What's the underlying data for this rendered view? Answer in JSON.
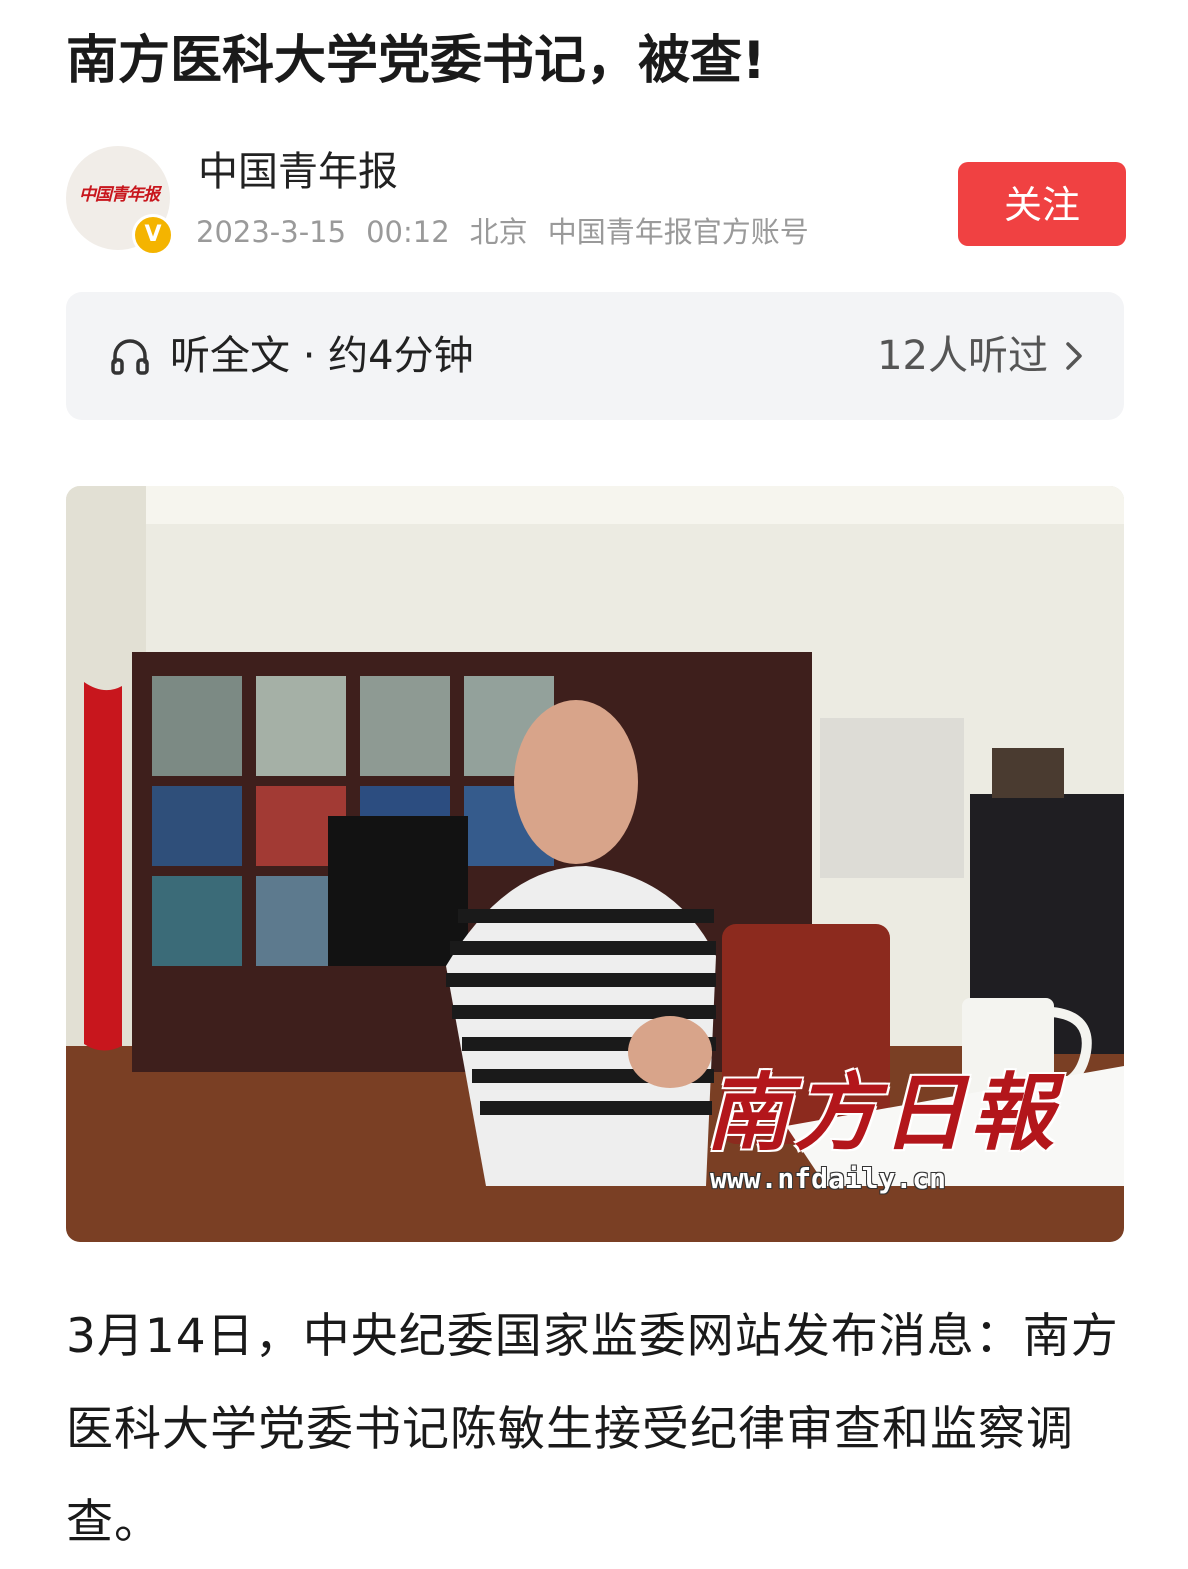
{
  "article": {
    "title": "南方医科大学党委书记，被查!",
    "author": {
      "name": "中国青年报",
      "avatar_logo_text": "中国青年报",
      "verified_badge": "V",
      "date": "2023-3-15",
      "time": "00:12",
      "location": "北京",
      "account_type": "中国青年报官方账号"
    },
    "follow_label": "关注",
    "listen": {
      "icon": "headphone-icon",
      "label": "听全文 · 约4分钟",
      "count_label": "12人听过",
      "chevron": "chevron-right-icon"
    },
    "photo": {
      "watermark_logo": "南方日報",
      "watermark_url": "www.nfdaily.cn"
    },
    "body": "3月14日，中央纪委国家监委网站发布消息：南方医科大学党委书记陈敏生接受纪律审查和监察调查。"
  },
  "colors": {
    "follow_button": "#f04142",
    "verify_badge": "#f4b400",
    "listen_bar_bg": "#f3f4f6",
    "meta_text": "#9a9a9a"
  }
}
